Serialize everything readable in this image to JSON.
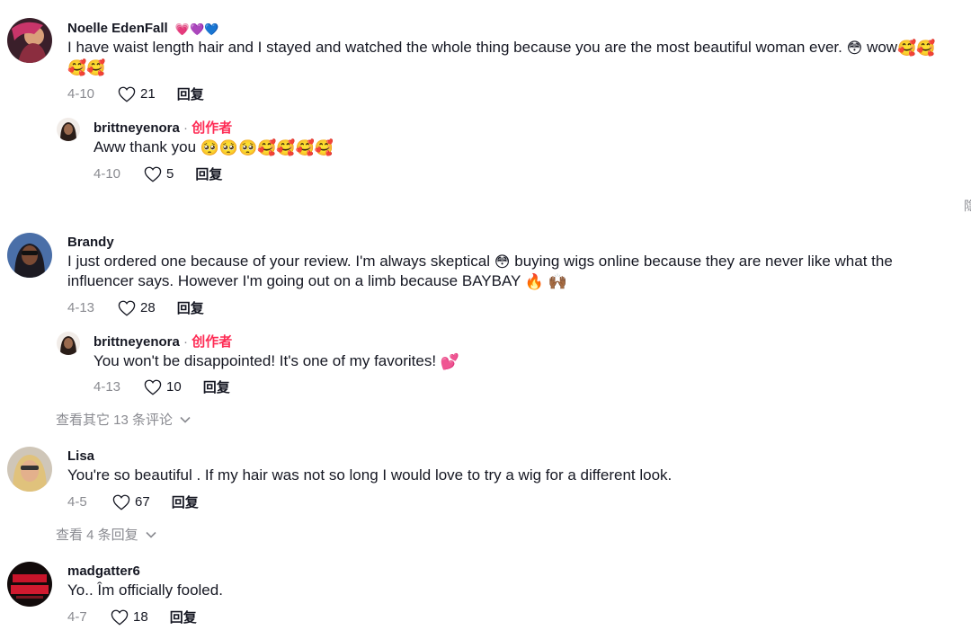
{
  "comments": [
    {
      "username": "Noelle EdenFall",
      "badge_emojis": "💗💜💙",
      "text_line1": "I have waist length hair and I stayed and watched the whole thing because you are the most beautiful woman ever.",
      "text_line1_emoji": "😳",
      "text_line1_tail": " wow",
      "text_line1_tail_emojis": "🥰🥰",
      "text_line2_emojis": "🥰🥰",
      "date": "4-10",
      "likes": "21",
      "reply_label": "回复",
      "reply": {
        "username": "brittneyenora",
        "separator": " · ",
        "creator_label": "创作者",
        "text": "Aww thank you",
        "text_emojis": "🥺🥺🥺🥰🥰🥰🥰",
        "date": "4-10",
        "likes": "5",
        "reply_label": "回复"
      }
    },
    {
      "username": "Brandy",
      "text_line1": "I just ordered one because of your review. I'm always skeptical",
      "text_line1_emoji": "😳",
      "text_line1_tail": " buying wigs online because they are never like what the",
      "text_line2": "influencer says. However I'm going out on a limb because BAYBAY",
      "text_line2_emojis": "🔥 🙌🏾",
      "date": "4-13",
      "likes": "28",
      "reply_label": "回复",
      "reply": {
        "username": "brittneyenora",
        "separator": " · ",
        "creator_label": "创作者",
        "text": "You won't be disappointed! It's one of my favorites!",
        "text_emojis": "💕",
        "date": "4-13",
        "likes": "10",
        "reply_label": "回复"
      },
      "view_more": "查看其它 13 条评论"
    },
    {
      "username": "Lisa",
      "text_line1": "You're so beautiful . If my hair was not so long I would love to try a wig for a different look.",
      "date": "4-5",
      "likes": "67",
      "reply_label": "回复",
      "view_more": "查看 4 条回复"
    },
    {
      "username": "madgatter6",
      "text_line1": "Yo.. Îm officially fooled.",
      "date": "4-7",
      "likes": "18",
      "reply_label": "回复"
    }
  ],
  "edge_char": "隐",
  "icons": {
    "like": "heart-outline-icon",
    "expand": "chevron-down-icon"
  },
  "colors": {
    "creator": "#fe2c55",
    "secondary_text": "#8a8b91",
    "primary_text": "#161823"
  }
}
